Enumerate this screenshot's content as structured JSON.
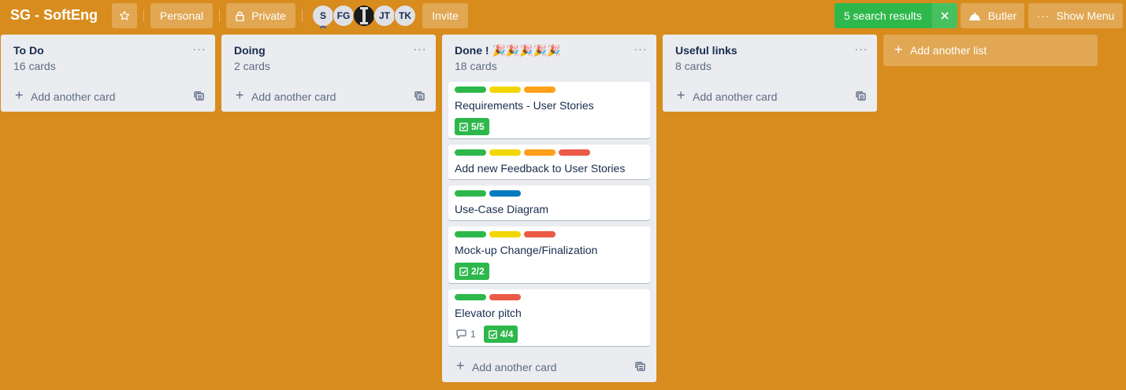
{
  "header": {
    "board_title": "SG - SoftEng",
    "personal_label": "Personal",
    "private_label": "Private",
    "members": [
      "S",
      "FG",
      "",
      "JT",
      "TK"
    ],
    "invite_label": "Invite",
    "search_results_label": "5 search results",
    "butler_label": "Butler",
    "show_menu_label": "Show Menu"
  },
  "lists": [
    {
      "title": "To Do",
      "count": "16 cards",
      "add_card_label": "Add another card"
    },
    {
      "title": "Doing",
      "count": "2 cards",
      "add_card_label": "Add another card"
    },
    {
      "title": "Done ! 🎉🎉🎉🎉🎉",
      "count": "18 cards",
      "add_card_label": "Add another card",
      "cards": [
        {
          "title": "Requirements - User Stories",
          "labels": [
            "#2eb84b",
            "#f2d600",
            "#ff9f1a"
          ],
          "checklist": "5/5"
        },
        {
          "title": "Add new Feedback to User Stories",
          "labels": [
            "#2eb84b",
            "#f2d600",
            "#ff9f1a",
            "#eb5a46"
          ]
        },
        {
          "title": "Use-Case Diagram",
          "labels": [
            "#2eb84b",
            "#0079bf"
          ]
        },
        {
          "title": "Mock-up Change/Finalization",
          "labels": [
            "#2eb84b",
            "#f2d600",
            "#eb5a46"
          ],
          "checklist": "2/2"
        },
        {
          "title": "Elevator pitch",
          "labels": [
            "#2eb84b",
            "#eb5a46"
          ],
          "comments": "1",
          "checklist": "4/4"
        }
      ]
    },
    {
      "title": "Useful links",
      "count": "8 cards",
      "add_card_label": "Add another card"
    }
  ],
  "add_list_label": "Add another list",
  "colors": {
    "board_bg": "#d88c1e",
    "search_green": "#2eb84b"
  }
}
